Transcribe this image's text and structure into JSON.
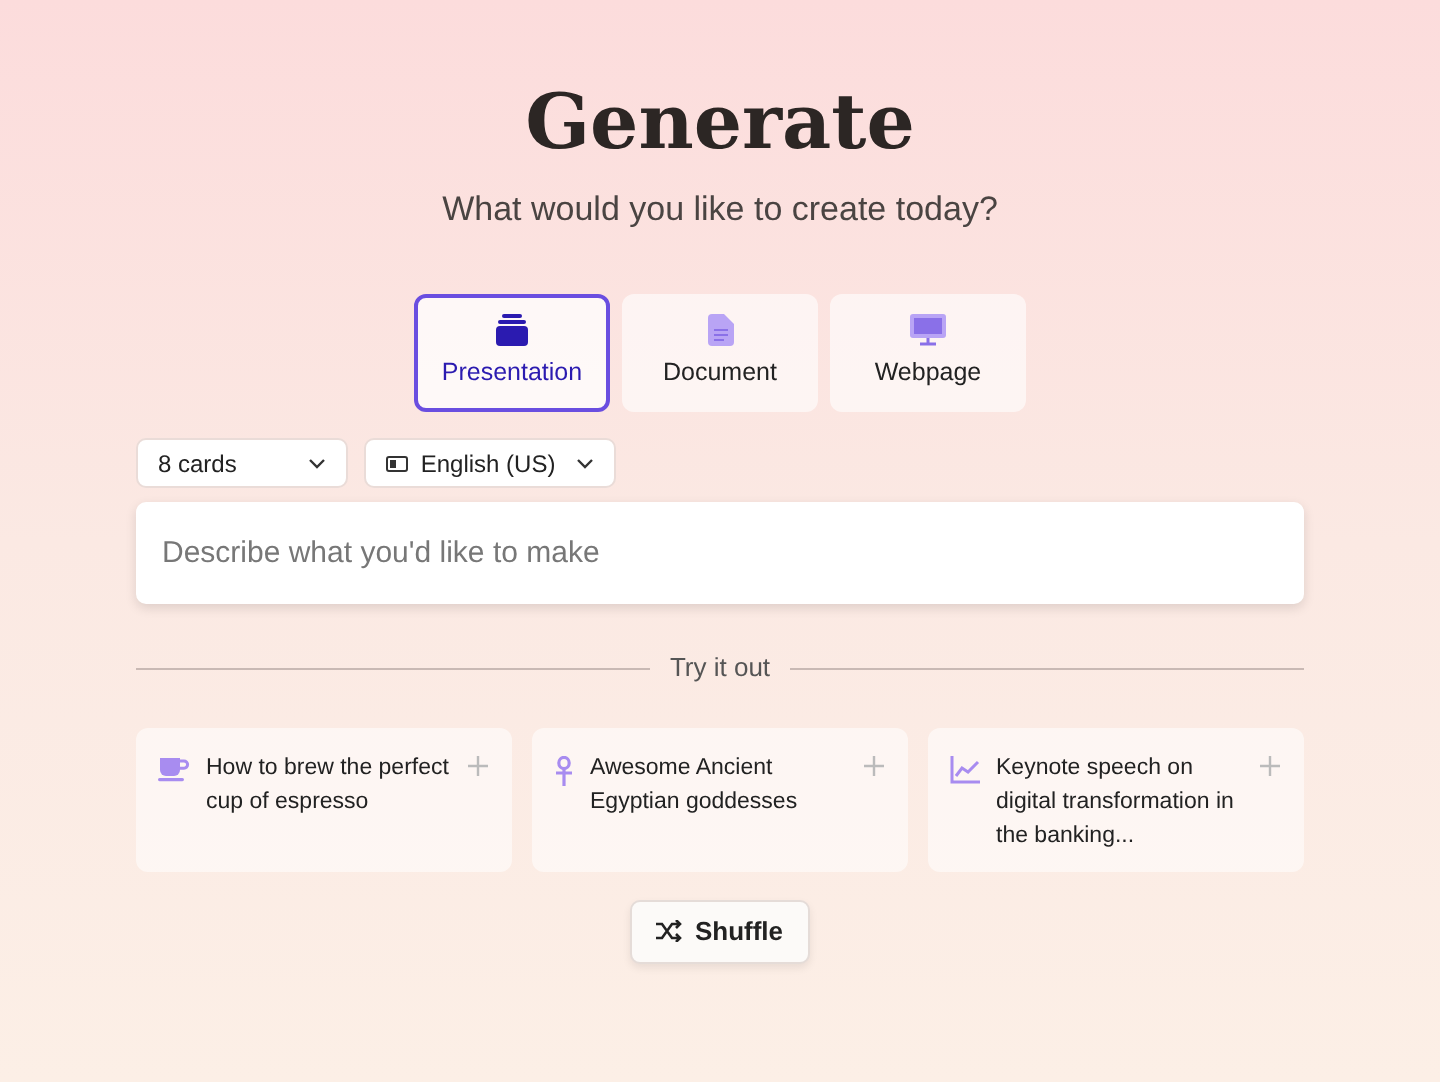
{
  "title": "Generate",
  "subtitle": "What would you like to create today?",
  "tabs": [
    {
      "label": "Presentation",
      "kind": "slides",
      "selected": true
    },
    {
      "label": "Document",
      "kind": "doc",
      "selected": false
    },
    {
      "label": "Webpage",
      "kind": "monitor",
      "selected": false
    }
  ],
  "dropdowns": [
    {
      "kind": "count",
      "value": "8 cards"
    },
    {
      "kind": "language",
      "value": "English (US)"
    }
  ],
  "prompt": {
    "placeholder": "Describe what you'd like to make"
  },
  "divider_label": "Try it out",
  "suggestions": [
    {
      "kind": "cup",
      "text": "How to brew the perfect cup of espresso"
    },
    {
      "kind": "ankh",
      "text": "Awesome Ancient Egyptian goddesses"
    },
    {
      "kind": "chart",
      "text": "Keynote speech on digital transformation in the banking..."
    }
  ],
  "shuffle_button": "Shuffle"
}
